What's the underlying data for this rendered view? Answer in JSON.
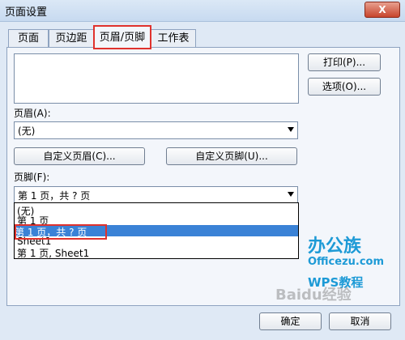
{
  "window": {
    "title": "页面设置",
    "close_glyph": "X"
  },
  "tabs": [
    "页面",
    "页边距",
    "页眉/页脚",
    "工作表"
  ],
  "side_buttons": {
    "print": "打印(P)...",
    "options": "选项(O)..."
  },
  "header": {
    "label": "页眉(A):",
    "value": "(无)",
    "custom_button": "自定义页眉(C)..."
  },
  "footer": {
    "label": "页脚(F):",
    "value": "第 1 页，共 ? 页",
    "custom_button": "自定义页脚(U)..."
  },
  "footer_options": [
    "(无)",
    "第 1 页",
    "第 1 页，共 ? 页",
    "Sheet1",
    "第 1 页, Sheet1"
  ],
  "footer_selected_index": 2,
  "bottom_buttons": {
    "ok": "确定",
    "cancel": "取消"
  },
  "logo": {
    "cn": "办公族",
    "en": "Officezu.com",
    "wps": "WPS教程"
  },
  "watermark": "Baidu经验",
  "colors": {
    "selection": "#3a82d6",
    "highlight_box": "#e0322d",
    "logo": "#1d9ad6"
  }
}
